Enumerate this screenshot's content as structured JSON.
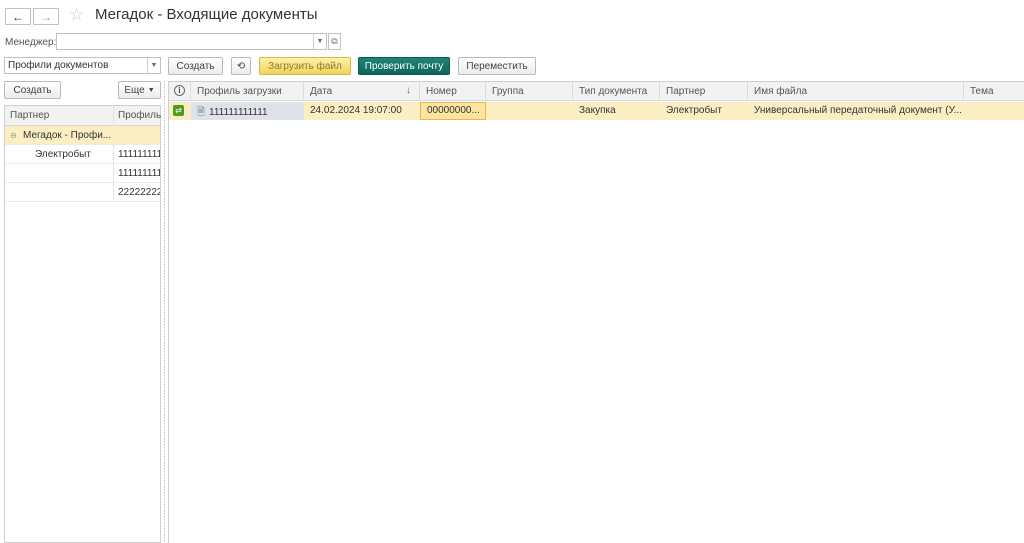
{
  "window": {
    "title": "Мегадок - Входящие документы",
    "back_icon": "←",
    "forward_icon": "→",
    "star_icon": "☆"
  },
  "manager": {
    "label": "Менеджер:",
    "value": ""
  },
  "profile_select": {
    "value": "Профили документов"
  },
  "toolbar": {
    "create_label": "Создать",
    "load_file_label": "Загрузить файл",
    "check_mail_label": "Проверить почту",
    "move_label": "Переместить"
  },
  "left_panel": {
    "create_label": "Создать",
    "more_label": "Еще",
    "columns": [
      "Партнер",
      "Профиль"
    ],
    "rows": [
      {
        "partner": "Мегадок - Профи...",
        "profile": "",
        "group": true
      },
      {
        "partner": "Электробыт",
        "profile": "111111111"
      },
      {
        "partner": "",
        "profile": "111111111"
      },
      {
        "partner": "",
        "profile": "22222222"
      }
    ]
  },
  "table": {
    "columns": [
      "Профиль загрузки",
      "Дата",
      "Номер",
      "Группа",
      "Тип документа",
      "Партнер",
      "Имя файла",
      "Тема"
    ],
    "rows": [
      {
        "profile": "111111111111",
        "date": "24.02.2024 19:07:00",
        "number": "00000000...",
        "group": "",
        "doc_type": "Закупка",
        "partner": "Электробыт",
        "file_name": "Универсальный передаточный документ (У...",
        "subject": ""
      }
    ]
  },
  "colors": {
    "accent_teal": "#0f665b",
    "accent_yellow": "#f2d357",
    "selected_row": "#fbeec3"
  }
}
